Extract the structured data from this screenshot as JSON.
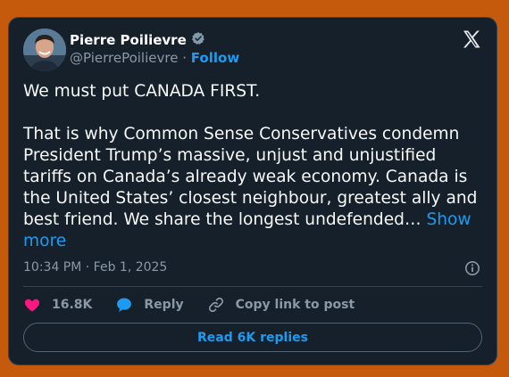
{
  "author": {
    "name": "Pierre Poilievre",
    "handle": "@PierrePoilievre",
    "separator": "·",
    "follow_label": "Follow",
    "verified": true
  },
  "post": {
    "paragraph1": "We must put CANADA FIRST.",
    "paragraph2": "That is why Common Sense Conservatives condemn President Trump’s massive, unjust and unjustified tariffs on Canada’s already weak economy. Canada is the United States’ closest neighbour, greatest ally and best friend. We share the longest undefended…",
    "show_more_label": "Show more",
    "timestamp": "10:34 PM · Feb 1, 2025"
  },
  "actions": {
    "likes": "16.8K",
    "reply_label": "Reply",
    "copy_link_label": "Copy link to post"
  },
  "replies_button_label": "Read 6K replies",
  "icons": {
    "logo": "x-logo-icon",
    "verified": "verified-badge-icon",
    "info": "info-icon",
    "like": "heart-icon",
    "reply": "reply-bubble-icon",
    "link": "link-icon"
  },
  "colors": {
    "background": "#c65a0c",
    "card": "#15202b",
    "accent": "#1d9bf0",
    "like": "#f91880",
    "muted": "#8b98a5"
  }
}
